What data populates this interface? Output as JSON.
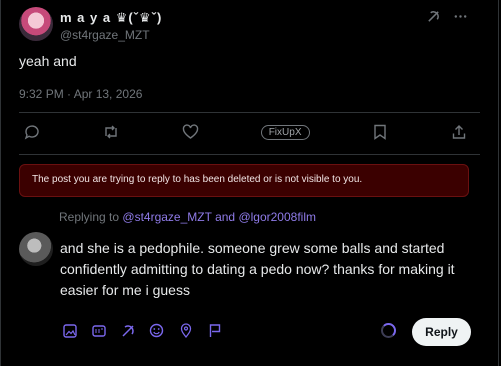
{
  "post": {
    "display_name": "m a y a ♛(ˇ♛ˇ)",
    "handle": "@st4rgaze_MZT",
    "text": "yeah and",
    "timestamp": "9:32 PM · Apr 13, 2026"
  },
  "actions": {
    "fixup_label": "FixUpX"
  },
  "alert": {
    "message": "The post you are trying to reply to has been deleted or is not visible to you."
  },
  "reply": {
    "replying_prefix": "Replying to",
    "mention_1": "@st4rgaze_MZT",
    "conjunction": "and",
    "mention_2": "@lgor2008film",
    "text": "and she is a pedophile. someone grew some balls and started confidently admitting to dating a pedo now? thanks for making it easier for me i guess",
    "button_label": "Reply"
  },
  "colors": {
    "accent": "#7b68ee",
    "alert_bg": "#3b0000",
    "muted": "#71767b"
  },
  "icons": [
    "grok-icon",
    "more-icon",
    "comment-icon",
    "retweet-icon",
    "like-icon",
    "bookmark-icon",
    "share-icon",
    "image-icon",
    "gif-icon",
    "grok-tool-icon",
    "emoji-icon",
    "location-icon",
    "flag-icon"
  ]
}
